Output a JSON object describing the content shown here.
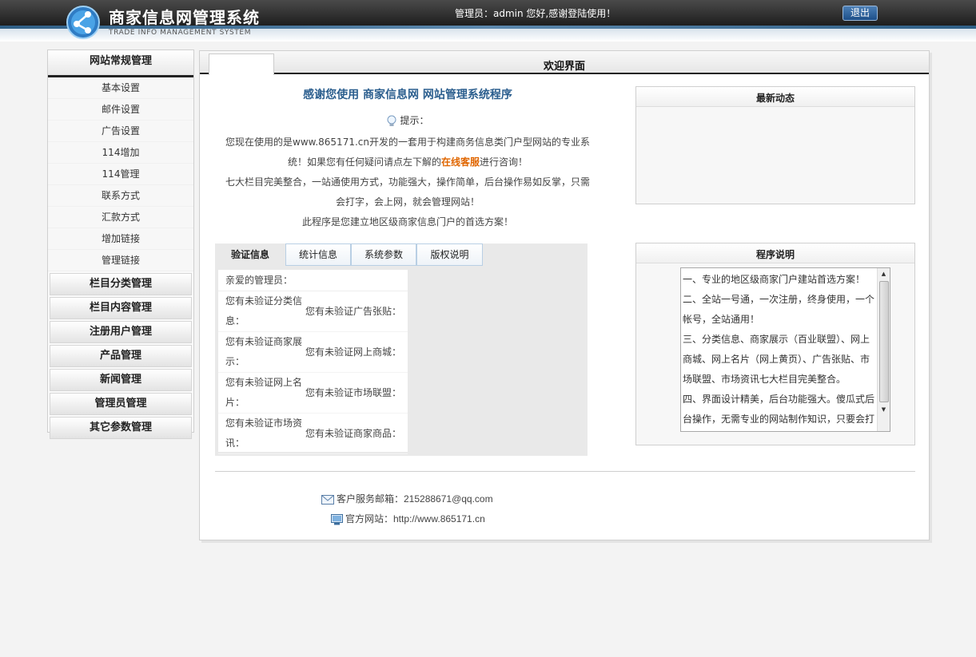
{
  "header": {
    "title": "商家信息网管理系统",
    "subtitle": "TRADE INFO MANAGEMENT SYSTEM",
    "welcome": "管理员：admin 您好,感谢登陆使用！",
    "logout_label": "退出"
  },
  "sidebar": {
    "group_title": "网站常规管理",
    "items": [
      {
        "label": "基本设置"
      },
      {
        "label": "邮件设置"
      },
      {
        "label": "广告设置"
      },
      {
        "label": "114增加"
      },
      {
        "label": "114管理"
      },
      {
        "label": "联系方式"
      },
      {
        "label": "汇款方式"
      },
      {
        "label": "增加链接"
      },
      {
        "label": "管理链接"
      }
    ],
    "sections": [
      {
        "label": "栏目分类管理"
      },
      {
        "label": "栏目内容管理"
      },
      {
        "label": "注册用户管理"
      },
      {
        "label": "产品管理"
      },
      {
        "label": "新闻管理"
      },
      {
        "label": "管理员管理"
      },
      {
        "label": "其它参数管理"
      }
    ]
  },
  "main": {
    "title": "欢迎界面",
    "intro_heading": "感谢您使用 商家信息网 网站管理系统程序",
    "tip_label": "提示：",
    "intro_line1": "您现在使用的是www.865171.cn开发的一套用于构建商务信息类门户型网站的专业系统！如果您有任何疑问请点左下解的",
    "intro_highlight": "在线客服",
    "intro_line1_end": "进行咨询！",
    "intro_line2": "七大栏目完美整合，一站通使用方式，功能强大，操作简单，后台操作易如反掌，只需会打字，会上网，就会管理网站！",
    "intro_line3": "此程序是您建立地区级商家信息门户的首选方案！"
  },
  "info_tabs": {
    "tabs": [
      {
        "label": "验证信息"
      },
      {
        "label": "统计信息"
      },
      {
        "label": "系统参数"
      },
      {
        "label": "版权说明"
      }
    ],
    "greeting": "亲爱的管理员：",
    "rows": [
      {
        "left": "您有未验证分类信息：",
        "right": "您有未验证广告张贴："
      },
      {
        "left": "您有未验证商家展示：",
        "right": "您有未验证网上商城："
      },
      {
        "left": "您有未验证网上名片：",
        "right": "您有未验证市场联盟："
      },
      {
        "left": "您有未验证市场资讯：",
        "right": "您有未验证商家商品："
      }
    ]
  },
  "news_box": {
    "title": "最新动态"
  },
  "desc_box": {
    "title": "程序说明",
    "text": "一、专业的地区级商家门户建站首选方案！\n二、全站一号通，一次注册，终身使用，一个帐号，全站通用！\n三、分类信息、商家展示（百业联盟）、网上商城、网上名片（网上黄页）、广告张贴、市场联盟、市场资讯七大栏目完美整合。\n四、界面设计精美，后台功能强大。傻瓜式后台操作，无需专业的网站制作知识，只要会打"
  },
  "footer": {
    "email_label": "客户服务邮箱：215288671@qq.com",
    "site_label": "官方网站：http://www.865171.cn"
  },
  "colors": {
    "header_bg": "#2a2a2a",
    "accent_blue": "#2b5e8e",
    "highlight_orange": "#e06600"
  }
}
